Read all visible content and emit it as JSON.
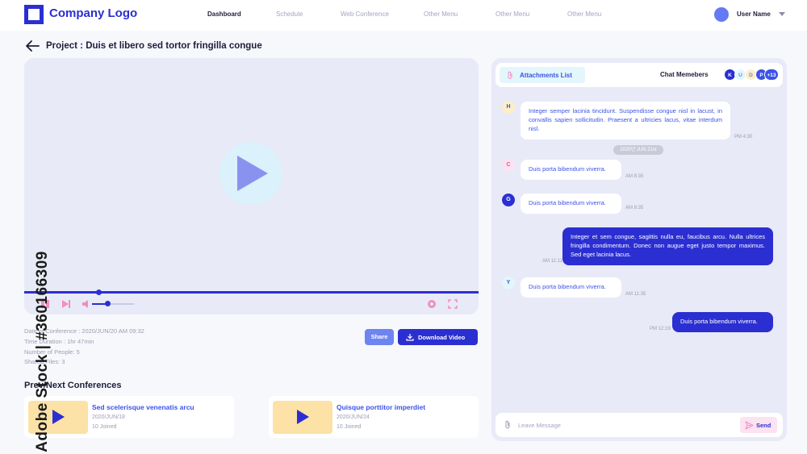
{
  "header": {
    "logo_text": "Company Logo",
    "nav": [
      "Dashboard",
      "Schedule",
      "Web Conference",
      "Other Menu",
      "Other Menu",
      "Other Menu"
    ],
    "user_name": "User Name"
  },
  "project": {
    "title": "Project : Duis et libero sed tortor fringilla congue"
  },
  "player": {
    "progress": 0.16,
    "volume": 0.35
  },
  "info": {
    "date": "Date of Conference : 2020/JUN/20 AM 09:32",
    "duration": "Time Duration : 1hr 47min",
    "people": "Number of People: 5",
    "files": "Shared Files: 3"
  },
  "actions": {
    "share": "Share",
    "download": "Download Video"
  },
  "prev_next": {
    "title": "Prev/Next Conferences",
    "items": [
      {
        "title": "Sed scelerisque venenatis arcu",
        "date": "2020/JUN/18",
        "joined": "10 Joined"
      },
      {
        "title": "Quisque porttitor imperdiet",
        "date": "2020/JUN/24",
        "joined": "10 Joined"
      }
    ]
  },
  "chat": {
    "attachments_label": "Attachments List",
    "members_label": "Chat Memebers",
    "members": [
      "K",
      "U",
      "D",
      "P",
      "+13"
    ],
    "date_pill": "2020년 JUN 21st",
    "messages": [
      {
        "from": "H",
        "text": "Integer semper lacinia tincidunt. Suspendisse congue nisl in lacust, in convallis sapien sollicitudin. Praesent a ultricies lacus, vitae interdum nisl.",
        "time": "PM 4:30"
      },
      {
        "from": "C",
        "text": "Duis porta bibendum viverra.",
        "time": "AM 8:35"
      },
      {
        "from": "G",
        "text": "Duis porta bibendum viverra.",
        "time": "AM 8:35"
      },
      {
        "from": "me",
        "text": "Integer et sem congue, sagittis nulla eu, faucibus arcu. Nulla ultrices fringilla condimentum. Donec non augue eget justo tempor maximus. Sed eget lacinia lacus.",
        "time": "AM 11:11"
      },
      {
        "from": "Y",
        "text": "Duis porta bibendum viverra.",
        "time": "AM 11:35"
      },
      {
        "from": "me",
        "text": "Duis porta bibendum viverra.",
        "time": "PM 12:19"
      }
    ],
    "input_placeholder": "Leave Message",
    "send_label": "Send"
  },
  "watermark": "Adobe Stock | #360166309",
  "colors": {
    "primary": "#2b2fd1",
    "accent": "#6e84f0",
    "panel": "#e8eaf7",
    "thumb": "#fce2a6"
  }
}
